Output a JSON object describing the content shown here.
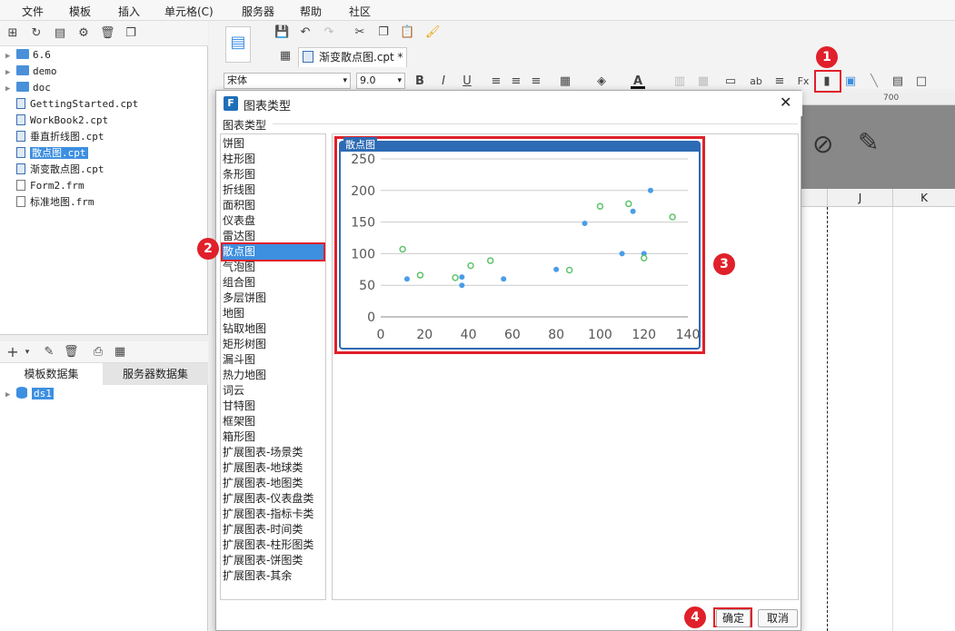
{
  "menu": [
    "文件",
    "模板",
    "插入",
    "单元格(C)",
    "服务器",
    "帮助",
    "社区"
  ],
  "tree": [
    {
      "label": "6.6",
      "kind": "folder"
    },
    {
      "label": "demo",
      "kind": "folder"
    },
    {
      "label": "doc",
      "kind": "folder"
    },
    {
      "label": "GettingStarted.cpt",
      "kind": "file"
    },
    {
      "label": "WorkBook2.cpt",
      "kind": "file"
    },
    {
      "label": "垂直折线图.cpt",
      "kind": "file"
    },
    {
      "label": "散点图.cpt",
      "kind": "file",
      "selected": true
    },
    {
      "label": "渐变散点图.cpt",
      "kind": "file"
    },
    {
      "label": "Form2.frm",
      "kind": "file"
    },
    {
      "label": "标准地图.frm",
      "kind": "file"
    }
  ],
  "dataset_tabs": [
    "模板数据集",
    "服务器数据集"
  ],
  "dataset_item": "ds1",
  "doc_tab": "渐变散点图.cpt *",
  "format": {
    "font": "宋体",
    "size": "9.0"
  },
  "ruler_mark": "700",
  "columns": [
    "J",
    "K"
  ],
  "dialog": {
    "title": "图表类型",
    "group_label": "图表类型",
    "types": [
      "饼图",
      "柱形图",
      "条形图",
      "折线图",
      "面积图",
      "仪表盘",
      "雷达图",
      "散点图",
      "气泡图",
      "组合图",
      "多层饼图",
      "地图",
      "钻取地图",
      "矩形树图",
      "漏斗图",
      "热力地图",
      "词云",
      "甘特图",
      "框架图",
      "箱形图",
      "扩展图表-场景类",
      "扩展图表-地球类",
      "扩展图表-地图类",
      "扩展图表-仪表盘类",
      "扩展图表-指标卡类",
      "扩展图表-时间类",
      "扩展图表-柱形图类",
      "扩展图表-饼图类",
      "扩展图表-其余"
    ],
    "selected_index": 7,
    "ok_label": "确定",
    "cancel_label": "取消"
  },
  "badges": [
    "1",
    "2",
    "3",
    "4"
  ],
  "chart_data": {
    "type": "scatter",
    "title": "散点图",
    "xlim": [
      0,
      140
    ],
    "ylim": [
      0,
      250
    ],
    "x_ticks": [
      "0",
      "20",
      "40",
      "60",
      "80",
      "100",
      "120",
      "140"
    ],
    "y_ticks": [
      "0",
      "50",
      "100",
      "150",
      "200",
      "250"
    ],
    "grid": true,
    "series": [
      {
        "color": "#4a9de8",
        "filled": true,
        "points": [
          [
            12,
            60
          ],
          [
            37,
            63
          ],
          [
            37,
            50
          ],
          [
            56,
            60
          ],
          [
            80,
            75
          ],
          [
            93,
            148
          ],
          [
            110,
            100
          ],
          [
            115,
            167
          ],
          [
            120,
            100
          ],
          [
            123,
            200
          ]
        ]
      },
      {
        "color": "#5fc46a",
        "filled": false,
        "points": [
          [
            10,
            107
          ],
          [
            18,
            66
          ],
          [
            34,
            62
          ],
          [
            41,
            81
          ],
          [
            50,
            89
          ],
          [
            86,
            74
          ],
          [
            100,
            175
          ],
          [
            113,
            179
          ],
          [
            120,
            93
          ],
          [
            133,
            158
          ]
        ]
      }
    ]
  }
}
